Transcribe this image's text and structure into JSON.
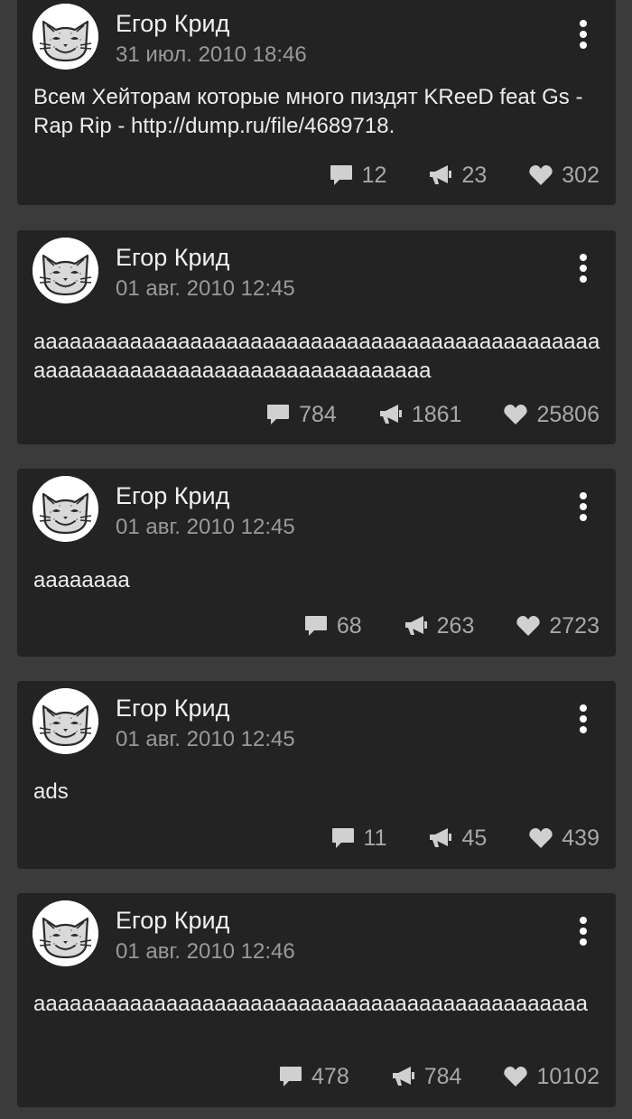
{
  "colors": {
    "page_background": "#3b3b3b",
    "card_background": "#232323",
    "author_text": "#f2f2f2",
    "date_text": "#9a9a9a",
    "body_text": "#ededed",
    "action_icon": "#d0d0d0",
    "action_count": "#a8a8a8"
  },
  "icons": {
    "avatar": "cat-face-avatar-icon",
    "more": "vertical-dots-menu-icon",
    "comments": "speech-bubble-icon",
    "reposts": "megaphone-icon",
    "likes": "heart-icon"
  },
  "posts": [
    {
      "author": "Егор Крид",
      "date": "31 июл. 2010 18:46",
      "text": "Всем Хейторам которые много пиздят KReeD feat Gs - Rap Rip - http://dump.ru/file/4689718.",
      "comments": "12",
      "reposts": "23",
      "likes": "302"
    },
    {
      "author": "Егор Крид",
      "date": "01 авг. 2010 12:45",
      "text": "аааааааааааааааааааааааааааааааааааааааааааааааааааааааааааааааааааааааааааааааа",
      "comments": "784",
      "reposts": "1861",
      "likes": "25806"
    },
    {
      "author": "Егор Крид",
      "date": "01 авг. 2010 12:45",
      "text": "аааааааа",
      "comments": "68",
      "reposts": "263",
      "likes": "2723"
    },
    {
      "author": "Егор Крид",
      "date": "01 авг. 2010 12:45",
      "text": "ads",
      "comments": "11",
      "reposts": "45",
      "likes": "439"
    },
    {
      "author": "Егор Крид",
      "date": "01 авг. 2010 12:46",
      "text": "аааааааааааааааааааааааааааааааааааааааааааааа",
      "comments": "478",
      "reposts": "784",
      "likes": "10102"
    }
  ]
}
